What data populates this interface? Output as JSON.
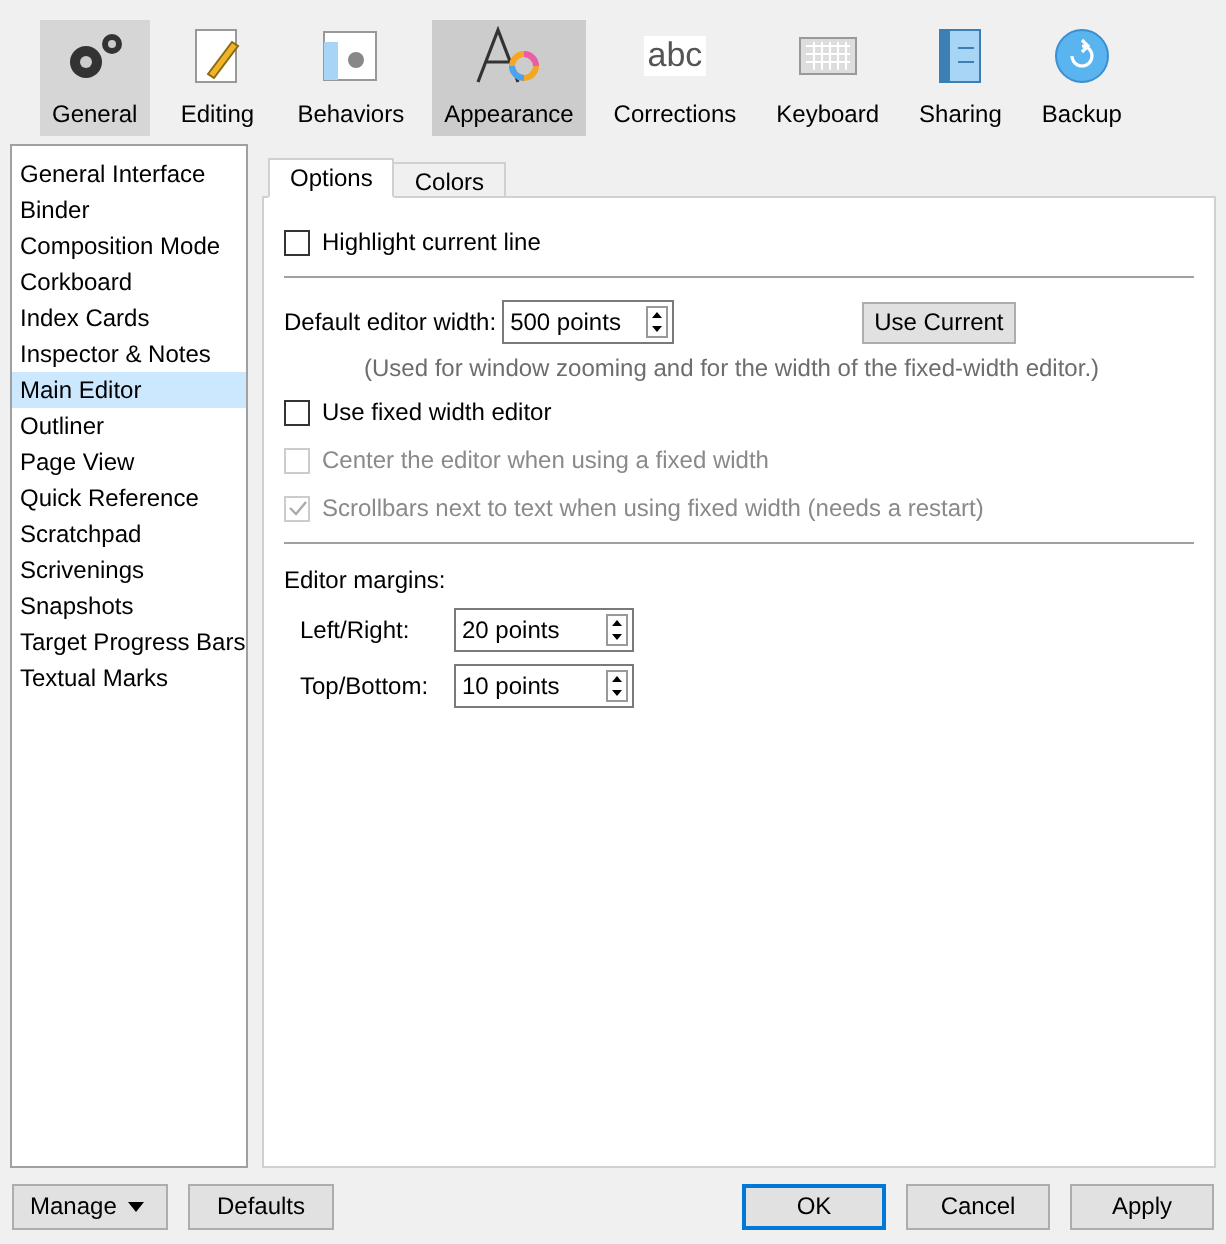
{
  "toolbar": [
    {
      "label": "General",
      "selected": false,
      "hovered": true
    },
    {
      "label": "Editing",
      "selected": false,
      "hovered": false
    },
    {
      "label": "Behaviors",
      "selected": false,
      "hovered": false
    },
    {
      "label": "Appearance",
      "selected": true,
      "hovered": false
    },
    {
      "label": "Corrections",
      "icon_text": "abc",
      "selected": false,
      "hovered": false
    },
    {
      "label": "Keyboard",
      "selected": false,
      "hovered": false
    },
    {
      "label": "Sharing",
      "selected": false,
      "hovered": false
    },
    {
      "label": "Backup",
      "selected": false,
      "hovered": false
    }
  ],
  "sidebar": {
    "items": [
      {
        "label": "General Interface",
        "selected": false
      },
      {
        "label": "Binder",
        "selected": false
      },
      {
        "label": "Composition Mode",
        "selected": false
      },
      {
        "label": "Corkboard",
        "selected": false
      },
      {
        "label": "Index Cards",
        "selected": false
      },
      {
        "label": "Inspector & Notes",
        "selected": false
      },
      {
        "label": "Main Editor",
        "selected": true
      },
      {
        "label": "Outliner",
        "selected": false
      },
      {
        "label": "Page View",
        "selected": false
      },
      {
        "label": "Quick Reference",
        "selected": false
      },
      {
        "label": "Scratchpad",
        "selected": false
      },
      {
        "label": "Scrivenings",
        "selected": false
      },
      {
        "label": "Snapshots",
        "selected": false
      },
      {
        "label": "Target Progress Bars",
        "selected": false
      },
      {
        "label": "Textual Marks",
        "selected": false
      }
    ]
  },
  "tabs": [
    {
      "label": "Options",
      "selected": true
    },
    {
      "label": "Colors",
      "selected": false
    }
  ],
  "options": [
    {
      "kind": "checkbox",
      "label": "Highlight current line",
      "checked": false,
      "disabled": false
    },
    {
      "kind": "divider"
    },
    {
      "kind": "spinner",
      "label": "Default editor width:",
      "value": "500 points",
      "button": "Use Current"
    },
    {
      "kind": "note",
      "text": "(Used for window zooming and for the width of the fixed-width editor.)"
    },
    {
      "kind": "checkbox",
      "label": "Use fixed width editor",
      "checked": false,
      "disabled": false
    },
    {
      "kind": "checkbox",
      "label": "Center the editor when using a fixed width",
      "checked": false,
      "disabled": true
    },
    {
      "kind": "checkbox",
      "label": "Scrollbars next to text when using fixed width (needs a restart)",
      "checked": true,
      "disabled": true
    },
    {
      "kind": "divider"
    },
    {
      "kind": "heading",
      "text": "Editor margins:"
    },
    {
      "kind": "margin",
      "label": "Left/Right:",
      "value": "20 points"
    },
    {
      "kind": "margin",
      "label": "Top/Bottom:",
      "value": "10 points"
    }
  ],
  "footer": {
    "left": [
      {
        "label": "Manage",
        "dropdown": true
      },
      {
        "label": "Defaults",
        "dropdown": false
      }
    ],
    "right": [
      {
        "label": "OK",
        "default": true
      },
      {
        "label": "Cancel",
        "default": false
      },
      {
        "label": "Apply",
        "default": false
      }
    ]
  }
}
